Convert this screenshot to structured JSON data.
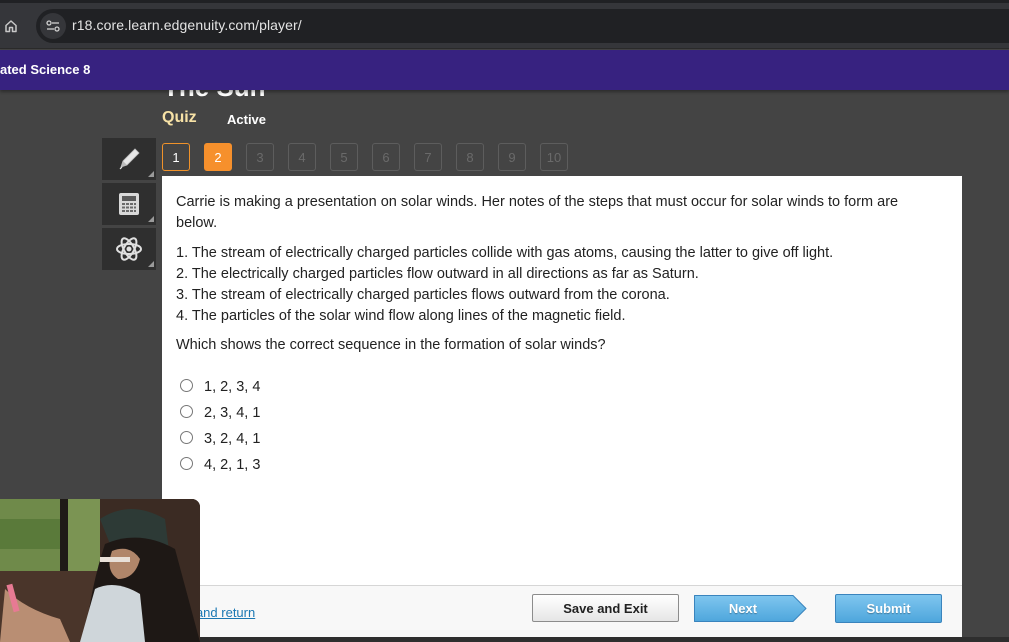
{
  "browser": {
    "url": "r18.core.learn.edgenuity.com/player/",
    "icons": [
      "home-icon",
      "site-info-icon"
    ]
  },
  "course": {
    "title": "ated Science 8"
  },
  "lesson": {
    "title": "The Sun",
    "activity_type": "Quiz",
    "status": "Active"
  },
  "question_nav": {
    "current": 2,
    "items": [
      {
        "label": "1",
        "state": "visited"
      },
      {
        "label": "2",
        "state": "current"
      },
      {
        "label": "3",
        "state": "disabled"
      },
      {
        "label": "4",
        "state": "disabled"
      },
      {
        "label": "5",
        "state": "disabled"
      },
      {
        "label": "6",
        "state": "disabled"
      },
      {
        "label": "7",
        "state": "disabled"
      },
      {
        "label": "8",
        "state": "disabled"
      },
      {
        "label": "9",
        "state": "disabled"
      },
      {
        "label": "10",
        "state": "disabled"
      }
    ]
  },
  "tools": [
    {
      "name": "pencil",
      "icon": "pencil-icon"
    },
    {
      "name": "calculator",
      "icon": "calculator-icon"
    },
    {
      "name": "science",
      "icon": "atom-icon"
    }
  ],
  "question": {
    "text": "Carrie is making a presentation on solar winds. Her notes of the steps that must occur for solar winds to form are below.",
    "steps": [
      "1. The stream of electrically charged particles collide with gas atoms, causing the latter to give off light.",
      "2. The electrically charged particles flow outward in all directions as far as Saturn.",
      "3. The stream of electrically charged particles flows outward from the corona.",
      "4. The particles of the solar wind flow along lines of the magnetic field."
    ],
    "prompt": "Which shows the correct sequence in the formation of solar winds?",
    "options": [
      "1, 2, 3, 4",
      "2, 3, 4, 1",
      "3, 2, 4, 1",
      "4, 2, 1, 3"
    ],
    "selected": null
  },
  "footer": {
    "mark_link": "k this and return",
    "save_label": "Save and Exit",
    "next_label": "Next",
    "submit_label": "Submit"
  },
  "colors": {
    "course_bar": "#372280",
    "accent_orange": "#f6902c",
    "quiz_label": "#f7e2a6",
    "button_blue": "#4ea6dc",
    "link_blue": "#1b78b3"
  }
}
